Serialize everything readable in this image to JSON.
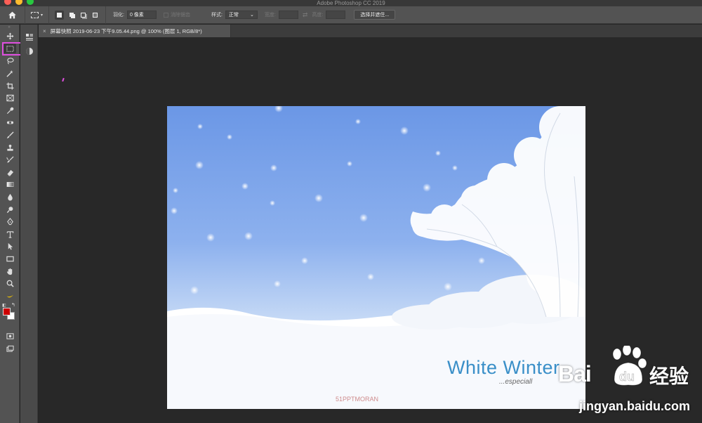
{
  "window": {
    "title": "Adobe Photoshop CC 2019"
  },
  "options_bar": {
    "feather_label": "羽化:",
    "feather_value": "0 像素",
    "antialias_label": "消除锯齿",
    "style_label": "样式:",
    "style_value": "正常",
    "width_label": "宽度:",
    "height_label": "高度:",
    "select_mask_label": "选择并遮住..."
  },
  "document": {
    "tab_title": "屏幕快照 2019-06-23 下午9.05.44.png @ 100% (图层 1, RGB/8*)",
    "image_title": "White Winter",
    "image_subtitle": "...especiall",
    "image_watermark": "51PPTMORAN"
  },
  "watermark": {
    "brand_text": "Bai",
    "brand_du": "du",
    "brand_jingyan": "经验",
    "url": "jingyan.baidu.com"
  },
  "colors": {
    "foreground": "#cc0000",
    "background": "#ffffff",
    "selection_highlight": "#e04fe0",
    "accent_text": "#3a8fc8"
  },
  "tools": [
    "move-tool",
    "rectangular-marquee-tool",
    "lasso-tool",
    "magic-wand-tool",
    "crop-tool",
    "frame-tool",
    "eyedropper-tool",
    "spot-healing-tool",
    "brush-tool",
    "clone-stamp-tool",
    "history-brush-tool",
    "eraser-tool",
    "gradient-tool",
    "blur-tool",
    "dodge-tool",
    "pen-tool",
    "type-tool",
    "path-selection-tool",
    "rectangle-tool",
    "hand-tool",
    "zoom-tool",
    "edit-toolbar"
  ]
}
